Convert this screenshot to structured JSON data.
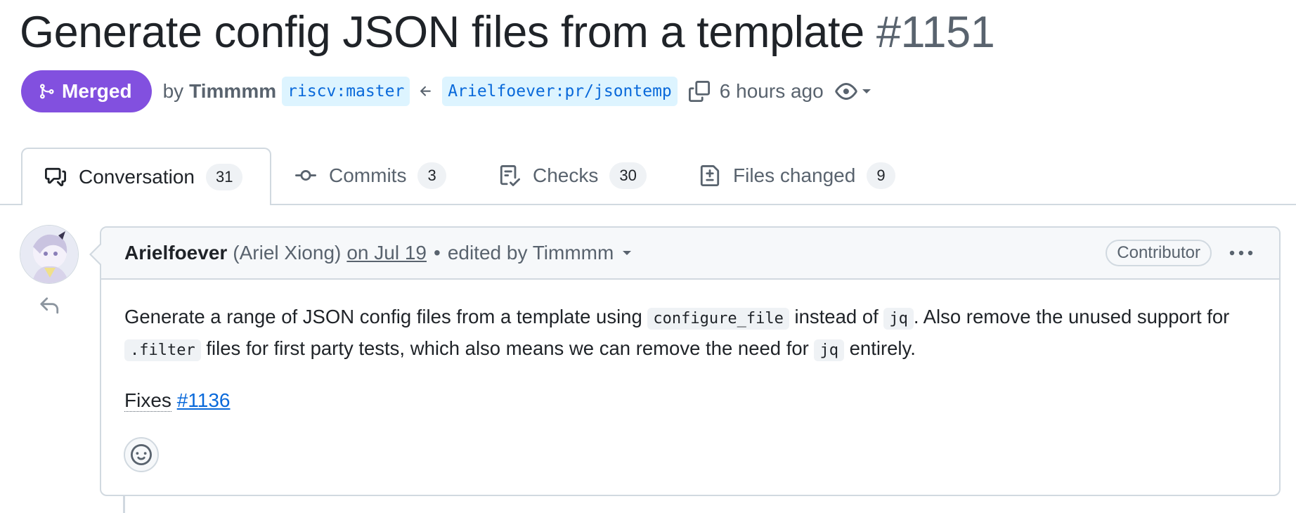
{
  "pr": {
    "title": "Generate config JSON files from a template",
    "number": "#1151",
    "state_label": "Merged",
    "by_label": "by",
    "author": "Timmmm",
    "base_branch": "riscv:master",
    "head_branch": "Arielfoever:pr/jsontemp",
    "time": "6 hours ago"
  },
  "tabs": [
    {
      "label": "Conversation",
      "count": "31",
      "icon": "comment-discussion-icon"
    },
    {
      "label": "Commits",
      "count": "3",
      "icon": "git-commit-icon"
    },
    {
      "label": "Checks",
      "count": "30",
      "icon": "checklist-icon"
    },
    {
      "label": "Files changed",
      "count": "9",
      "icon": "file-diff-icon"
    }
  ],
  "comment": {
    "login": "Arielfoever",
    "fullname": "(Ariel Xiong)",
    "date": "on Jul 19",
    "dot": "•",
    "edited": "edited by Timmmm",
    "badge": "Contributor",
    "body": {
      "t1": "Generate a range of JSON config files from a template using ",
      "c1": "configure_file",
      "t2": " instead of ",
      "c2": "jq",
      "t3": ". Also remove the unused support for ",
      "c3": ".filter",
      "t4": " files for first party tests, which also means we can remove the need for ",
      "c4": "jq",
      "t5": " entirely."
    },
    "fixes_label": "Fixes",
    "fixes_link": "#1136"
  },
  "colors": {
    "merged": "#8250df",
    "link": "#0969da",
    "branch_bg": "#ddf4ff",
    "muted": "#59636e",
    "border": "#d1d9e0"
  }
}
